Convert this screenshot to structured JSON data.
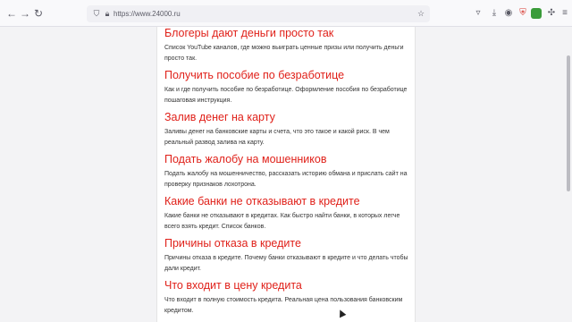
{
  "browser": {
    "url": "https://www.24000.ru"
  },
  "entries": [
    {
      "title": "Блогеры дают деньги просто так",
      "desc": "Список YouTube каналов, где можно выиграть ценные призы или получить деньги просто так."
    },
    {
      "title": "Получить пособие по безработице",
      "desc": "Как и где получить пособие по безработице. Оформление пособия по безработице пошаговая инструкция."
    },
    {
      "title": "Залив денег на карту",
      "desc": "Заливы денег на банковские карты и счета, что это такое и какой риск. В чем реальный развод залива на карту."
    },
    {
      "title": "Подать жалобу на мошенников",
      "desc": "Подать жалобу на мошенничество, рассказать историю обмана и прислать сайт на проверку признаков лохотрона."
    },
    {
      "title": "Какие банки не отказывают в кредите",
      "desc": "Какие банки не отказывают в кредитах. Как быстро найти банки, в которых легче всего взять кредит. Список банков."
    },
    {
      "title": "Причины отказа в кредите",
      "desc": "Причины отказа в кредите. Почему банки отказывают в кредите и что делать чтобы дали кредит."
    },
    {
      "title": "Что входит в цену кредита",
      "desc": "Что входит в полную стоимость кредита. Реальная цена пользования банковским кредитом."
    }
  ]
}
